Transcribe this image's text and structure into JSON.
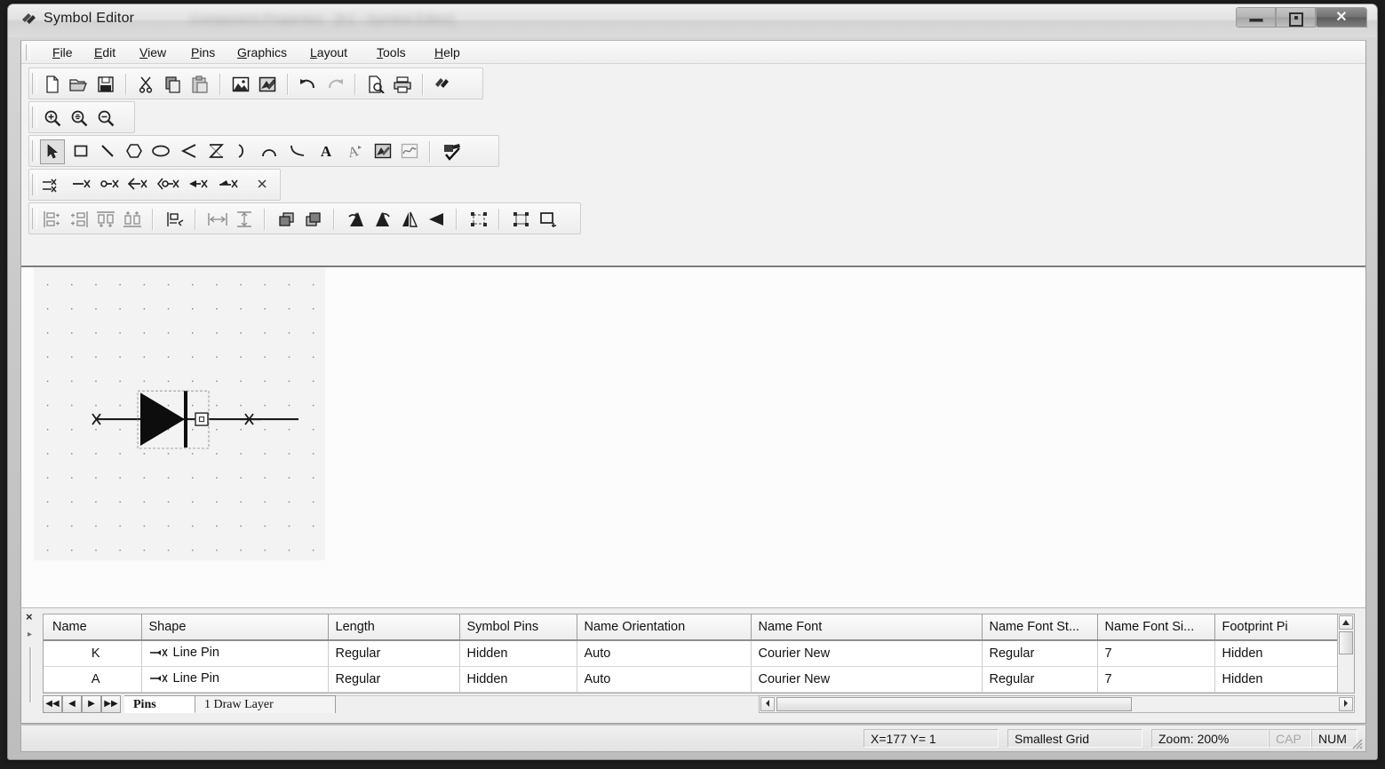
{
  "window": {
    "title": "Symbol Editor",
    "ghost_title": "Component Properties - [K1 - Symbol Editor]",
    "icon": "symbol-editor-icon",
    "buttons": {
      "minimize": "minimize-icon",
      "maximize": "restore-icon",
      "close": "close-icon"
    }
  },
  "menubar": {
    "items": [
      {
        "label": "File",
        "accel": "F"
      },
      {
        "label": "Edit",
        "accel": "E"
      },
      {
        "label": "View",
        "accel": "V"
      },
      {
        "label": "Pins",
        "accel": "P"
      },
      {
        "label": "Graphics",
        "accel": "G"
      },
      {
        "label": "Layout",
        "accel": "L"
      },
      {
        "label": "Tools",
        "accel": "T"
      },
      {
        "label": "Help",
        "accel": "H"
      }
    ]
  },
  "toolbars": {
    "standard": [
      {
        "name": "new-file-icon",
        "tip": "New"
      },
      {
        "name": "open-folder-icon",
        "tip": "Open"
      },
      {
        "name": "save-disk-icon",
        "tip": "Save"
      },
      {
        "sep": true
      },
      {
        "name": "scissors-cut-icon",
        "tip": "Cut"
      },
      {
        "name": "copy-icon",
        "tip": "Copy"
      },
      {
        "name": "paste-icon",
        "tip": "Paste"
      },
      {
        "sep": true
      },
      {
        "name": "insert-image-icon",
        "tip": "Insert Picture"
      },
      {
        "name": "edit-image-icon",
        "tip": "Edit Picture"
      },
      {
        "sep": true
      },
      {
        "name": "undo-icon",
        "tip": "Undo"
      },
      {
        "name": "redo-icon",
        "tip": "Redo"
      },
      {
        "sep": true
      },
      {
        "name": "print-preview-icon",
        "tip": "Print Preview"
      },
      {
        "name": "print-icon",
        "tip": "Print"
      },
      {
        "sep": true
      },
      {
        "name": "about-icon",
        "tip": "About"
      }
    ],
    "zoom": [
      {
        "name": "zoom-in-icon",
        "tip": "Zoom In"
      },
      {
        "name": "zoom-fit-icon",
        "tip": "Zoom To Fit"
      },
      {
        "name": "zoom-out-icon",
        "tip": "Zoom Out"
      }
    ],
    "graphics": [
      {
        "name": "select-arrow-icon",
        "tip": "Select",
        "pressed": true
      },
      {
        "name": "rectangle-icon",
        "tip": "Rectangle"
      },
      {
        "name": "line-icon",
        "tip": "Line"
      },
      {
        "name": "polygon-icon",
        "tip": "Polygon"
      },
      {
        "name": "ellipse-icon",
        "tip": "Ellipse"
      },
      {
        "name": "polyline-icon",
        "tip": "Polyline"
      },
      {
        "name": "bezier-icon",
        "tip": "Bezier"
      },
      {
        "name": "arc-icon",
        "tip": "Arc"
      },
      {
        "name": "arc-alt-icon",
        "tip": "Arc 2"
      },
      {
        "name": "curve-icon",
        "tip": "Curve"
      },
      {
        "name": "text-icon",
        "tip": "Text"
      },
      {
        "name": "rotated-text-icon",
        "tip": "Rotated Text"
      },
      {
        "name": "picture-icon",
        "tip": "Picture"
      },
      {
        "name": "plot-icon",
        "tip": "Plot"
      },
      {
        "sep": true
      },
      {
        "name": "check-symbol-icon",
        "tip": "Check Symbol"
      }
    ],
    "pins": [
      {
        "name": "multi-pin-icon",
        "tip": "Add Multiple Pins"
      },
      {
        "name": "line-pin-icon",
        "tip": "Line Pin"
      },
      {
        "name": "dot-pin-icon",
        "tip": "Dot Pin"
      },
      {
        "name": "arrow-pin-icon",
        "tip": "Arrow Pin"
      },
      {
        "name": "dot-arrow-pin-icon",
        "tip": "Dot Arrow Pin"
      },
      {
        "name": "wedge-pin-icon",
        "tip": "Wedge Pin"
      },
      {
        "name": "flag-pin-icon",
        "tip": "Flag Pin"
      },
      {
        "name": "short-pin-icon",
        "tip": "Short Pin"
      }
    ],
    "layout": [
      {
        "name": "align-left-icon",
        "tip": "Align Left"
      },
      {
        "name": "align-right-icon",
        "tip": "Align Right"
      },
      {
        "name": "align-top-icon",
        "tip": "Align Top"
      },
      {
        "name": "align-bottom-icon",
        "tip": "Align Bottom"
      },
      {
        "sep": true
      },
      {
        "name": "align-to-grid-icon",
        "tip": "Align To Grid"
      },
      {
        "sep": true
      },
      {
        "name": "space-horizontal-icon",
        "tip": "Space Horizontally"
      },
      {
        "name": "space-vertical-icon",
        "tip": "Space Vertically"
      },
      {
        "sep": true
      },
      {
        "name": "bring-to-front-icon",
        "tip": "Bring To Front"
      },
      {
        "name": "send-to-back-icon",
        "tip": "Send To Back"
      },
      {
        "sep": true
      },
      {
        "name": "rotate-left-icon",
        "tip": "Rotate Left"
      },
      {
        "name": "rotate-right-icon",
        "tip": "Rotate Right"
      },
      {
        "name": "flip-horizontal-icon",
        "tip": "Flip Horizontal"
      },
      {
        "name": "flip-vertical-icon",
        "tip": "Flip Vertical"
      },
      {
        "sep": true
      },
      {
        "name": "group-icon",
        "tip": "Group"
      },
      {
        "sep": true
      },
      {
        "name": "ungroup-icon",
        "tip": "Ungroup"
      },
      {
        "name": "resize-icon",
        "tip": "Resize"
      }
    ]
  },
  "canvas": {
    "symbol": "diode-symbol",
    "selected": true
  },
  "pin_grid": {
    "columns": [
      "Name",
      "Shape",
      "Length",
      "Symbol Pins",
      "Name Orientation",
      "Name Font",
      "Name Font St...",
      "Name Font Si...",
      "Footprint Pi"
    ],
    "rows": [
      {
        "name": "K",
        "shape": "Line Pin",
        "length": "Regular",
        "symbol_pins": "Hidden",
        "name_orientation": "Auto",
        "name_font": "Courier New",
        "name_font_style": "Regular",
        "name_font_size": "7",
        "footprint_pins": "Hidden"
      },
      {
        "name": "A",
        "shape": "Line Pin",
        "length": "Regular",
        "symbol_pins": "Hidden",
        "name_orientation": "Auto",
        "name_font": "Courier New",
        "name_font_style": "Regular",
        "name_font_size": "7",
        "footprint_pins": "Hidden"
      }
    ]
  },
  "tabs": {
    "nav": [
      {
        "name": "first-record-button",
        "glyph": "◀◀"
      },
      {
        "name": "prev-record-button",
        "glyph": "◀"
      },
      {
        "name": "next-record-button",
        "glyph": "▶"
      },
      {
        "name": "last-record-button",
        "glyph": "▶▶"
      }
    ],
    "items": [
      {
        "label": "Pins",
        "active": true
      },
      {
        "label": "1 Draw Layer",
        "active": false
      }
    ]
  },
  "panel": {
    "close_glyph": "×",
    "expand_glyph": "▸"
  },
  "statusbar": {
    "coords": "X=177 Y=  1",
    "grid": "Smallest Grid",
    "zoom": "Zoom: 200%",
    "caps": "CAP",
    "num": "NUM"
  }
}
